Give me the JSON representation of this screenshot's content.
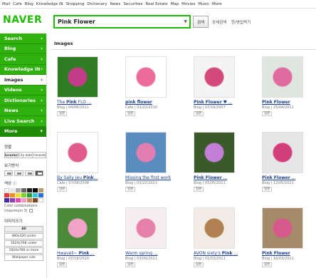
{
  "topnav": [
    "Mail",
    "Cafe",
    "Blog",
    "Knowledge iN",
    "Shopping",
    "Dictionary",
    "News",
    "Securities",
    "Real Estate",
    "Map",
    "Movies",
    "Music",
    "More"
  ],
  "logo": "NAVER",
  "search": {
    "value": "Pink Flower",
    "button": "검색",
    "links": [
      "상세검색",
      "한/영입력기"
    ]
  },
  "sidebar": {
    "items": [
      "Search",
      "Blog",
      "Cafe",
      "Knowledge iN",
      "Images",
      "Videos",
      "Dictionaries",
      "News",
      "Live Search",
      "More"
    ],
    "active": "Images"
  },
  "options": {
    "sort_title": "정렬",
    "sort": [
      "Accuracy",
      "City date",
      "Chinasdos"
    ],
    "view_title": "보기방식",
    "color_title": "색상",
    "color_combo": "Color combinations (maximum 3)",
    "size_title": "이미지크기",
    "sizes": [
      "All",
      "480x320 under",
      "1024x768 under",
      "1024x768 or more",
      "Wallpaper size"
    ],
    "swatches": [
      "#ffffff",
      "#e8e8e8",
      "#aaaaaa",
      "#666666",
      "#222222",
      "#000000",
      "#b79a6b",
      "#e63939",
      "#f48a20",
      "#f5dd2c",
      "#7cd22d",
      "#2c9b3a",
      "#31c6d9",
      "#2d6fe0",
      "#3f2ea5",
      "#8a3fb8",
      "#e04bb3",
      "#f39ac9",
      "#c98c5c",
      "#7a4a22",
      "#ffffff"
    ]
  },
  "section": "Images",
  "results": [
    {
      "title": "The Pink FLO ...",
      "hl": "Pink",
      "pre": "The ",
      "post": " FLO ...",
      "source": "Blog",
      "date": "04/06/2011",
      "tag": "일본",
      "c1": "#2e7d22",
      "c2": "#c23c88"
    },
    {
      "title": "pink flower",
      "hl": "pink flower",
      "pre": "",
      "post": "",
      "source": "Cafe",
      "date": "01/22/2010",
      "tag": "일본",
      "c1": "#ffffff",
      "c2": "#ea6a9a"
    },
    {
      "title": "Pink Flower ♥ ...",
      "hl": "Pink Flower",
      "pre": "",
      "post": " ♥ ...",
      "source": "Blog",
      "date": "07/16/2007",
      "tag": "일본",
      "c1": "#f4f4f4",
      "c2": "#d34a7a"
    },
    {
      "title": "Pink Flower",
      "hl": "Pink Flower",
      "pre": "",
      "post": "",
      "source": "Blog",
      "date": "25/04/2011",
      "tag": "일본",
      "c1": "#dfe6e0",
      "c2": "#e06aa0"
    },
    {
      "title": "By Sally jeu Pink...",
      "hl": "Pink",
      "pre": "By Sally jeu ",
      "post": "...",
      "source": "Cafe",
      "date": "07/06/2008",
      "tag": "일본",
      "c1": "#ffffff",
      "c2": "#e05a8a"
    },
    {
      "title": "Missing the first work",
      "hl": "",
      "pre": "Missing the first work",
      "post": "",
      "source": "Blog",
      "date": "03/22/2011",
      "tag": "일본",
      "c1": "#5a8cc0",
      "c2": "#e27eb0"
    },
    {
      "title": "Pink Flower ...",
      "hl": "Pink Flower",
      "pre": "",
      "post": " ...",
      "source": "Blog",
      "date": "05/05/2011",
      "tag": "일본",
      "c1": "#3b5a2a",
      "c2": "#c27ed8"
    },
    {
      "title": "Pink Flower ...",
      "hl": "Pink Flower",
      "pre": "",
      "post": " ...",
      "source": "Blog",
      "date": "12/05/2011",
      "tag": "일본",
      "c1": "#e6e6e6",
      "c2": "#d23d7c"
    },
    {
      "title": "Hwaveli~ Pink ...",
      "hl": "Pink",
      "pre": "Hwaveli~ ",
      "post": " ...",
      "source": "Blog",
      "date": "07/19/2010",
      "tag": "일본",
      "c1": "#4b8a3a",
      "c2": "#f1a3c8"
    },
    {
      "title": "Warm spring ...",
      "hl": "",
      "pre": "Warm spring ...",
      "post": "",
      "source": "Blog",
      "date": "03/09/2011",
      "tag": "일본",
      "c1": "#f5eef0",
      "c2": "#e680a8"
    },
    {
      "title": "AVON sixty's Pink ...",
      "hl": "Pink",
      "pre": "AVON sixty's ",
      "post": " ...",
      "source": "Blog",
      "date": "01/03/2011",
      "tag": "일본",
      "c1": "#f1ece6",
      "c2": "#b08050"
    },
    {
      "title": "Pink Flower",
      "hl": "Pink Flower",
      "pre": "",
      "post": "",
      "source": "Blog",
      "date": "16/03/2011",
      "tag": "일본",
      "c1": "#a58a6a",
      "c2": "#d65a8c"
    }
  ]
}
